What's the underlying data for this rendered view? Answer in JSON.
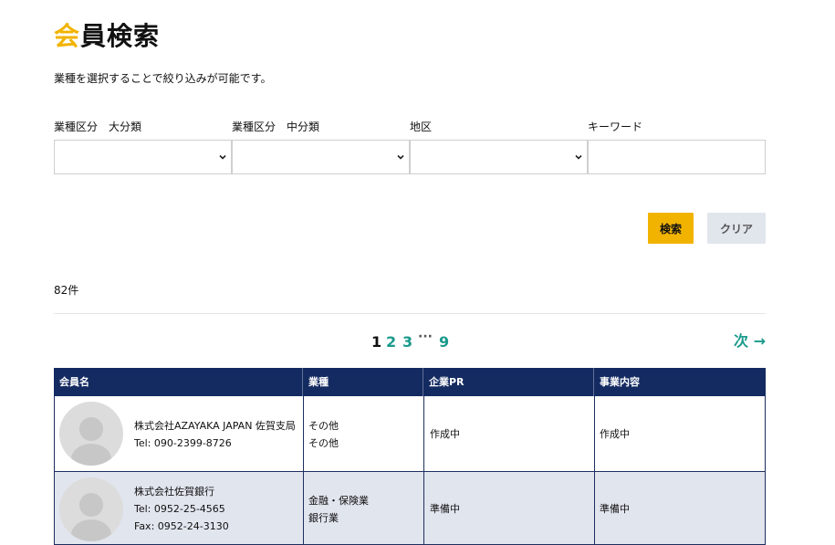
{
  "header": {
    "title_accent": "会",
    "title_rest": "員検索",
    "description": "業種を選択することで絞り込みが可能です。"
  },
  "filters": {
    "major_label": "業種区分　大分類",
    "middle_label": "業種区分　中分類",
    "area_label": "地区",
    "keyword_label": "キーワード",
    "keyword_value": ""
  },
  "buttons": {
    "search": "検索",
    "clear": "クリア"
  },
  "results": {
    "count": "82件"
  },
  "pagination": {
    "current": "1",
    "page2": "2",
    "page3": "3",
    "ellipsis": "···",
    "last": "9",
    "next": "次 →"
  },
  "table": {
    "headers": [
      "会員名",
      "業種",
      "企業PR",
      "事業内容"
    ],
    "rows": [
      {
        "name": "株式会社AZAYAKA JAPAN 佐賀支局",
        "tel": "Tel: 090-2399-8726",
        "fax": "",
        "industry": [
          "その他",
          "その他"
        ],
        "pr": "作成中",
        "business": "作成中"
      },
      {
        "name": "株式会社佐賀銀行",
        "tel": "Tel: 0952-25-4565",
        "fax": "Fax: 0952-24-3130",
        "industry": [
          "金融・保険業",
          "銀行業"
        ],
        "pr": "準備中",
        "business": "準備中"
      }
    ]
  },
  "colors": {
    "accent": "#f2b300",
    "header_bg": "#142b61",
    "link": "#1a9a8c",
    "row_alt": "#e1e5ee"
  }
}
